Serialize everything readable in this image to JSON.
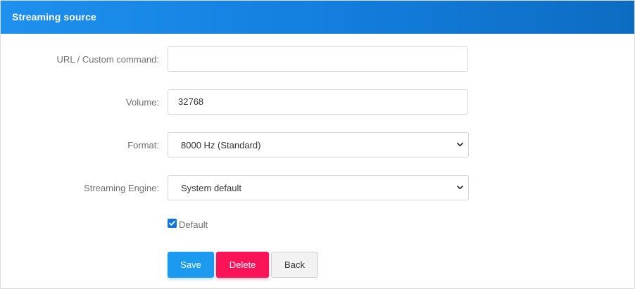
{
  "panel": {
    "title": "Streaming source"
  },
  "form": {
    "url": {
      "label": "URL / Custom command:",
      "value": ""
    },
    "volume": {
      "label": "Volume:",
      "value": "32768"
    },
    "format": {
      "label": "Format:",
      "selected": "8000 Hz (Standard)"
    },
    "engine": {
      "label": "Streaming Engine:",
      "selected": "System default"
    },
    "default": {
      "label": "Default",
      "checked": true
    }
  },
  "buttons": {
    "save": "Save",
    "delete": "Delete",
    "back": "Back"
  },
  "colors": {
    "header": "#137fdf",
    "save": "#1b9af0",
    "delete": "#fa1457",
    "back": "#f2f2f2"
  },
  "icons": {
    "select_arrow": "chevron-down-icon",
    "checkbox": "check-icon"
  }
}
